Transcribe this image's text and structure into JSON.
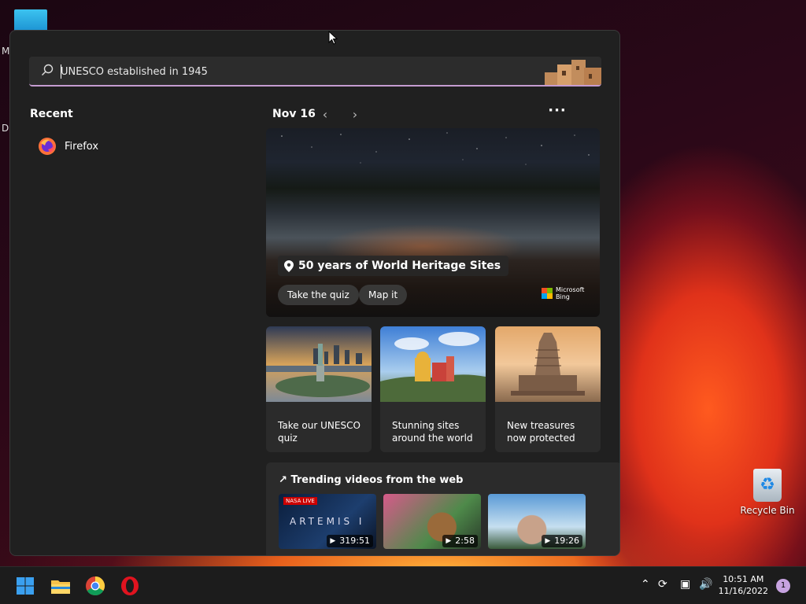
{
  "desktop": {
    "letters": [
      "M",
      "Da"
    ],
    "recycle_bin_label": "Recycle Bin"
  },
  "search": {
    "query": "UNESCO established in 1945"
  },
  "recent": {
    "title": "Recent",
    "items": [
      {
        "label": "Firefox",
        "icon": "firefox-icon"
      }
    ]
  },
  "highlights": {
    "date": "Nov 16",
    "hero": {
      "title": "50 years of World Heritage Sites",
      "buttons": [
        "Take the quiz",
        "Map it"
      ],
      "brand_line1": "Microsoft",
      "brand_line2": "Bing"
    },
    "cards": [
      {
        "text": "Take our UNESCO quiz"
      },
      {
        "text": "Stunning sites around the world"
      },
      {
        "text": "New treasures now protected"
      }
    ],
    "trending": {
      "title": "Trending videos from the web",
      "videos": [
        {
          "duration": "319:51",
          "badge": "NASA LIVE",
          "caption": "ARTEMIS I"
        },
        {
          "duration": "2:58"
        },
        {
          "duration": "19:26"
        }
      ]
    }
  },
  "taskbar": {
    "apps": [
      "start-icon",
      "file-explorer-icon",
      "chrome-icon",
      "opera-icon"
    ],
    "time": "10:51 AM",
    "date": "11/16/2022",
    "notifications": "1"
  },
  "colors": {
    "accent": "#c59cd1",
    "panel": "#202020",
    "card": "#2b2b2b"
  }
}
